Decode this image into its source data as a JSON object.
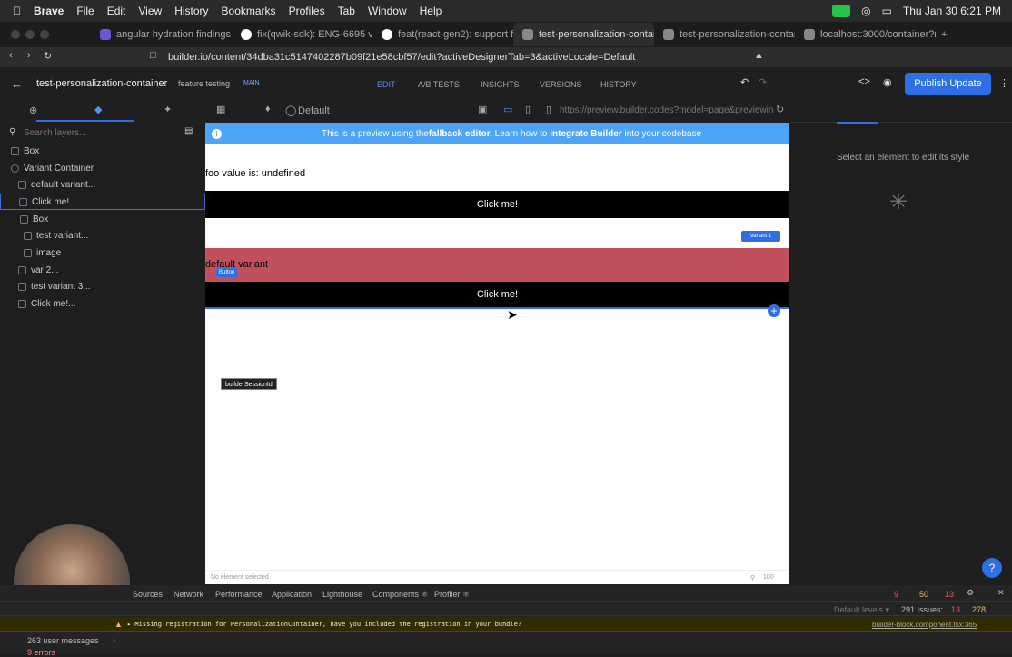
{
  "menubar": {
    "app": "Brave",
    "items": [
      "File",
      "Edit",
      "View",
      "History",
      "Bookmarks",
      "Profiles",
      "Tab",
      "Window",
      "Help"
    ],
    "clock": "Thu Jan 30  6:21 PM"
  },
  "tabs": [
    {
      "label": "angular hydration findings",
      "color": "#6b57d6"
    },
    {
      "label": "fix(qwik-sdk): ENG-6695 visual",
      "color": "#ffffff"
    },
    {
      "label": "feat(react-gen2): support for var",
      "color": "#ffffff"
    },
    {
      "label": "test-personalization-container",
      "color": "#888888"
    },
    {
      "label": "test-personalization-container",
      "color": "#888888"
    },
    {
      "label": "localhost:3000/container?model",
      "color": "#888888"
    }
  ],
  "address": {
    "url": "builder.io/content/34dba31c5147402287b09f21e58cbf57/edit?activeDesignerTab=3&activeLocale=Default"
  },
  "builder": {
    "title": "test-personalization-container",
    "branch": "feature testing",
    "branch_tag": "MAIN",
    "nav": [
      "EDIT",
      "A/B TESTS",
      "INSIGHTS",
      "VERSIONS",
      "HISTORY"
    ],
    "publish": "Publish Update",
    "locale": "Default",
    "preview_url": "https://preview.builder.codes?model=page&previewing"
  },
  "layers": {
    "search_placeholder": "Search layers...",
    "items": [
      {
        "label": "Box",
        "indent": 0
      },
      {
        "label": "Variant Container",
        "indent": 0
      },
      {
        "label": "default variant...",
        "indent": 1
      },
      {
        "label": "Click me!...",
        "indent": 1
      },
      {
        "label": "Box",
        "indent": 1
      },
      {
        "label": "test variant...",
        "indent": 2
      },
      {
        "label": "image",
        "indent": 2
      },
      {
        "label": "var 2...",
        "indent": 1
      },
      {
        "label": "test variant 3...",
        "indent": 1
      },
      {
        "label": "Click me!...",
        "indent": 1
      }
    ]
  },
  "canvas": {
    "banner_pre": "This is a preview using the ",
    "banner_b1": "fallback editor.",
    "banner_mid": " Learn how to ",
    "banner_b2": "integrate Builder",
    "banner_post": " into your codebase",
    "foo_text": "foo value is: undefined",
    "button1": "Click me!",
    "variant_badge": "Variant 1",
    "default_variant": "default variant",
    "button_tag": "Button",
    "button2": "Click me!",
    "session_tag": "builderSessionId",
    "footer_left": "No element selected",
    "footer_right": "100"
  },
  "right_panel": {
    "hint": "Select an element to edit its style"
  },
  "devtools": {
    "tabs": [
      "Sources",
      "Network",
      "Performance",
      "Application",
      "Lighthouse",
      "Components ⚛",
      "Profiler ⚛"
    ],
    "errors": "9",
    "warnings": "50",
    "info": "13",
    "issues": "291 Issues:",
    "issue_err": "13",
    "issue_warn": "278",
    "levels": "Default levels ▾",
    "console_msg": "▸ Missing registration for PersonalizationContainer, have you included the registration in your bundle?",
    "console_src": "builder-block.component.tsx:365",
    "user_messages": "263 user messages",
    "error_count": "9 errors"
  },
  "colors": {
    "accent": "#2f6fe4",
    "banner": "#4da3f5",
    "variant_bg": "#c1505c"
  }
}
